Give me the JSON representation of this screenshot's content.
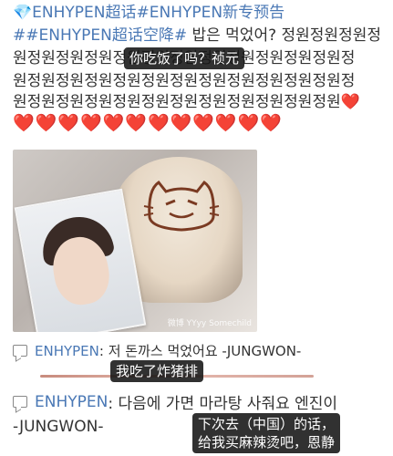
{
  "post": {
    "line1": "💎ENHYPEN超话#ENHYPEN新专预告",
    "line2_tag": "##ENHYPEN超话空降#",
    "line2_text": " 밥은 먹었어? 정원정원정원정",
    "line3_text": "원정원정원정원정원정원정원정원정원정원정원정원정",
    "line4_text": "원정원정원정원정원정원정원정원정원정원정원정원정",
    "line5_text": "원정원정원정원정원정원정원정원정원정원정원정원❤️",
    "hearts": "❤️❤️❤️❤️❤️❤️❤️❤️❤️❤️❤️❤️",
    "subtitle_top": "你吃饭了吗？祯元"
  },
  "photo": {
    "watermark": "微博 YYyy Somechild"
  },
  "comments": [
    {
      "name": "ENHYPEN",
      "text": ": 저 돈까스 먹었어요 -JUNGWON-",
      "subtitle": "我吃了炸猪排"
    },
    {
      "name": "ENHYPEN",
      "text": ": 다음에 가면 마라탕 사줘요 엔진이",
      "text2": "-JUNGWON-",
      "subtitle_line1": "下次去（中国）的话，",
      "subtitle_line2": "给我买麻辣烫吧，恩静"
    }
  ],
  "colors": {
    "tag_blue": "#4a78b5",
    "heart_red": "#e0303a"
  }
}
